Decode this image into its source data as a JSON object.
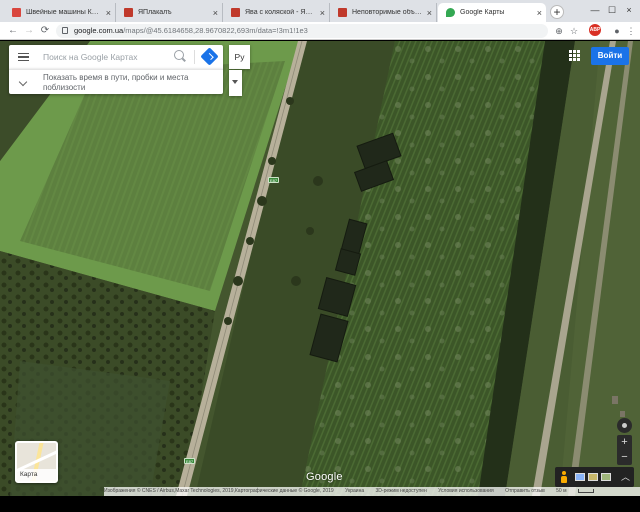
{
  "browser": {
    "tabs": [
      {
        "label": "Швейные машины КОНЦЕ",
        "color": "#d9463e"
      },
      {
        "label": "ЯПлакалъ",
        "color": "#c0392b"
      },
      {
        "label": "Ява с коляской - ЯПлакалъ",
        "color": "#c0392b"
      },
      {
        "label": "Неповторимые объекты, о",
        "color": "#c0392b"
      },
      {
        "label": "Google Карты",
        "color": "#34a853"
      }
    ],
    "tab_close": "×",
    "new_tab": "+",
    "window_controls": [
      "—",
      "☐",
      "×"
    ],
    "url_main": "google.com.ua",
    "url_rest": "/maps/@45.6184658,28.9670822,693m/data=!3m1!1e3",
    "adblock_label": "ABP"
  },
  "maps": {
    "search_placeholder": "Поиск на Google Картах",
    "hint": "Показать время в пути, пробки и места поблизости",
    "language_btn": "Ру",
    "signin_label": "Войти",
    "layer_label": "Карта",
    "road_shield": "E87",
    "logo": "Google",
    "attribution": {
      "imagery": "Изображения © CNES / Airbus,Maxar Technologies, 2019,Картографические данные © Google, 2019",
      "country": "Украина",
      "mode_3d": "3D-режим недоступен",
      "terms": "Условия использования",
      "feedback": "Отправить отзыв",
      "scale": "50 м"
    }
  },
  "colors": {
    "accent": "#1a73e8",
    "field_light": "#6d9a4b",
    "field_dark": "#3a4a26",
    "road": "#b7b09a",
    "pegman": "#f9ab00"
  }
}
